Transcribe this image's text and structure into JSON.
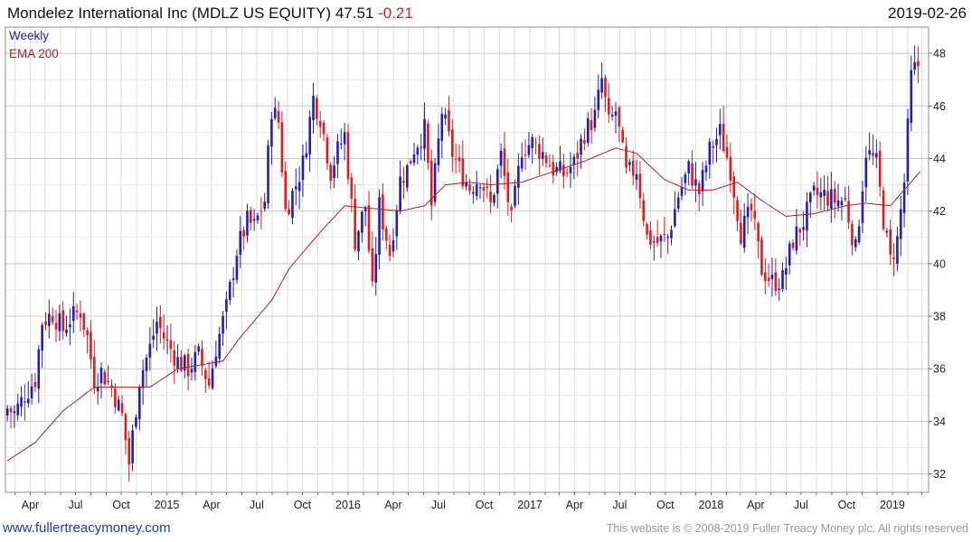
{
  "header": {
    "name": "Mondelez International Inc (MDLZ US EQUITY)",
    "price": "47.51",
    "change": "-0.21",
    "date": "2019-02-26"
  },
  "footer": {
    "site": "www.fullertreacymoney.com",
    "copyright": "This website is © 2008-2019 Fuller Treacy Money plc. All rights reserved"
  },
  "colors": {
    "up": "#1f1fb4",
    "down": "#e01b1b",
    "ema": "#b02020",
    "grid": "#dcdcdc"
  },
  "chart_data": {
    "type": "candlestick",
    "interval_label": "Weekly",
    "overlay_label": "EMA 200",
    "ylim": [
      31.3,
      49.0
    ],
    "y_ticks": [
      32,
      34,
      36,
      38,
      40,
      42,
      44,
      46,
      48
    ],
    "x_ticks": [
      {
        "label": "Apr",
        "date": "2014-04-01"
      },
      {
        "label": "Jul",
        "date": "2014-07-01"
      },
      {
        "label": "Oct",
        "date": "2014-10-01"
      },
      {
        "label": "2015",
        "date": "2015-01-01"
      },
      {
        "label": "Apr",
        "date": "2015-04-01"
      },
      {
        "label": "Jul",
        "date": "2015-07-01"
      },
      {
        "label": "Oct",
        "date": "2015-10-01"
      },
      {
        "label": "2016",
        "date": "2016-01-01"
      },
      {
        "label": "Apr",
        "date": "2016-04-01"
      },
      {
        "label": "Jul",
        "date": "2016-07-01"
      },
      {
        "label": "Oct",
        "date": "2016-10-01"
      },
      {
        "label": "2017",
        "date": "2017-01-01"
      },
      {
        "label": "Apr",
        "date": "2017-04-01"
      },
      {
        "label": "Jul",
        "date": "2017-07-01"
      },
      {
        "label": "Oct",
        "date": "2017-10-01"
      },
      {
        "label": "2018",
        "date": "2018-01-01"
      },
      {
        "label": "Apr",
        "date": "2018-04-01"
      },
      {
        "label": "Jul",
        "date": "2018-07-01"
      },
      {
        "label": "Oct",
        "date": "2018-10-01"
      },
      {
        "label": "2019",
        "date": "2019-01-01"
      }
    ],
    "x_range": [
      "2014-02-10",
      "2019-03-15"
    ],
    "close_keypoints": [
      [
        "2014-02-14",
        34.5
      ],
      [
        "2014-02-28",
        34.3
      ],
      [
        "2014-03-21",
        35.0
      ],
      [
        "2014-04-11",
        35.6
      ],
      [
        "2014-04-25",
        37.8
      ],
      [
        "2014-05-16",
        38.1
      ],
      [
        "2014-06-06",
        37.5
      ],
      [
        "2014-06-20",
        37.9
      ],
      [
        "2014-07-11",
        38.2
      ],
      [
        "2014-07-25",
        37.2
      ],
      [
        "2014-08-08",
        35.6
      ],
      [
        "2014-08-22",
        35.9
      ],
      [
        "2014-09-12",
        35.3
      ],
      [
        "2014-10-03",
        34.2
      ],
      [
        "2014-10-17",
        32.4
      ],
      [
        "2014-11-07",
        35.6
      ],
      [
        "2014-11-28",
        36.8
      ],
      [
        "2014-12-12",
        37.8
      ],
      [
        "2014-12-26",
        37.2
      ],
      [
        "2015-01-23",
        36.3
      ],
      [
        "2015-02-13",
        36.0
      ],
      [
        "2015-03-06",
        36.5
      ],
      [
        "2015-03-27",
        35.4
      ],
      [
        "2015-04-10",
        36.8
      ],
      [
        "2015-05-01",
        38.3
      ],
      [
        "2015-05-22",
        40.5
      ],
      [
        "2015-06-12",
        41.6
      ],
      [
        "2015-06-26",
        41.4
      ],
      [
        "2015-07-17",
        42.4
      ],
      [
        "2015-07-31",
        45.9
      ],
      [
        "2015-08-14",
        45.4
      ],
      [
        "2015-08-28",
        42.0
      ],
      [
        "2015-09-18",
        43.0
      ],
      [
        "2015-10-02",
        43.8
      ],
      [
        "2015-10-23",
        46.3
      ],
      [
        "2015-11-06",
        45.6
      ],
      [
        "2015-11-27",
        43.5
      ],
      [
        "2015-12-11",
        44.3
      ],
      [
        "2015-12-25",
        44.9
      ],
      [
        "2016-01-15",
        40.9
      ],
      [
        "2016-02-05",
        42.2
      ],
      [
        "2016-02-19",
        38.9
      ],
      [
        "2016-03-04",
        42.2
      ],
      [
        "2016-03-25",
        40.4
      ],
      [
        "2016-04-15",
        43.2
      ],
      [
        "2016-04-29",
        43.6
      ],
      [
        "2016-05-13",
        44.4
      ],
      [
        "2016-06-03",
        45.1
      ],
      [
        "2016-06-17",
        42.2
      ],
      [
        "2016-07-08",
        45.8
      ],
      [
        "2016-07-29",
        44.2
      ],
      [
        "2016-08-12",
        43.6
      ],
      [
        "2016-09-02",
        42.9
      ],
      [
        "2016-09-23",
        43.3
      ],
      [
        "2016-10-14",
        42.2
      ],
      [
        "2016-11-04",
        44.1
      ],
      [
        "2016-11-25",
        41.6
      ],
      [
        "2016-12-16",
        44.4
      ],
      [
        "2017-01-06",
        44.6
      ],
      [
        "2017-01-27",
        44.2
      ],
      [
        "2017-02-17",
        43.6
      ],
      [
        "2017-03-10",
        43.4
      ],
      [
        "2017-03-31",
        43.8
      ],
      [
        "2017-04-21",
        45.0
      ],
      [
        "2017-05-12",
        45.6
      ],
      [
        "2017-05-26",
        47.0
      ],
      [
        "2017-06-09",
        45.3
      ],
      [
        "2017-06-23",
        45.8
      ],
      [
        "2017-07-14",
        43.4
      ],
      [
        "2017-08-04",
        43.6
      ],
      [
        "2017-08-25",
        41.0
      ],
      [
        "2017-09-15",
        40.8
      ],
      [
        "2017-10-06",
        41.0
      ],
      [
        "2017-10-27",
        42.6
      ],
      [
        "2017-11-17",
        43.6
      ],
      [
        "2017-12-08",
        42.7
      ],
      [
        "2017-12-29",
        44.3
      ],
      [
        "2018-01-19",
        45.0
      ],
      [
        "2018-02-09",
        43.6
      ],
      [
        "2018-03-02",
        41.2
      ],
      [
        "2018-03-23",
        42.0
      ],
      [
        "2018-04-13",
        39.8
      ],
      [
        "2018-05-04",
        39.3
      ],
      [
        "2018-05-25",
        39.4
      ],
      [
        "2018-06-15",
        40.9
      ],
      [
        "2018-07-06",
        41.6
      ],
      [
        "2018-07-27",
        42.6
      ],
      [
        "2018-08-17",
        42.6
      ],
      [
        "2018-09-07",
        42.4
      ],
      [
        "2018-09-28",
        42.4
      ],
      [
        "2018-10-19",
        40.5
      ],
      [
        "2018-11-09",
        44.3
      ],
      [
        "2018-11-30",
        43.8
      ],
      [
        "2018-12-14",
        41.7
      ],
      [
        "2018-12-28",
        40.1
      ],
      [
        "2019-01-11",
        40.9
      ],
      [
        "2019-01-25",
        43.1
      ],
      [
        "2019-02-08",
        47.1
      ],
      [
        "2019-02-22",
        47.7
      ],
      [
        "2019-02-26",
        47.51
      ]
    ],
    "ema_keypoints": [
      [
        "2014-02-14",
        32.5
      ],
      [
        "2014-04-11",
        33.2
      ],
      [
        "2014-06-06",
        34.4
      ],
      [
        "2014-08-08",
        35.3
      ],
      [
        "2014-10-03",
        35.3
      ],
      [
        "2014-11-28",
        35.3
      ],
      [
        "2015-01-23",
        36.0
      ],
      [
        "2015-03-27",
        36.2
      ],
      [
        "2015-04-24",
        36.3
      ],
      [
        "2015-05-29",
        37.2
      ],
      [
        "2015-07-31",
        38.6
      ],
      [
        "2015-09-04",
        39.8
      ],
      [
        "2015-11-06",
        41.2
      ],
      [
        "2015-12-25",
        42.2
      ],
      [
        "2016-02-19",
        42.1
      ],
      [
        "2016-04-15",
        42.0
      ],
      [
        "2016-06-03",
        42.2
      ],
      [
        "2016-07-15",
        43.0
      ],
      [
        "2016-09-02",
        43.1
      ],
      [
        "2016-10-14",
        43.0
      ],
      [
        "2016-12-16",
        43.1
      ],
      [
        "2017-02-17",
        43.5
      ],
      [
        "2017-04-21",
        43.9
      ],
      [
        "2017-06-23",
        44.4
      ],
      [
        "2017-08-04",
        44.2
      ],
      [
        "2017-09-29",
        43.2
      ],
      [
        "2017-11-17",
        42.8
      ],
      [
        "2018-01-05",
        42.8
      ],
      [
        "2018-02-23",
        43.1
      ],
      [
        "2018-04-13",
        42.4
      ],
      [
        "2018-06-01",
        41.8
      ],
      [
        "2018-07-27",
        41.9
      ],
      [
        "2018-09-28",
        42.2
      ],
      [
        "2018-11-09",
        42.3
      ],
      [
        "2018-12-28",
        42.2
      ],
      [
        "2019-02-26",
        43.5
      ]
    ]
  }
}
